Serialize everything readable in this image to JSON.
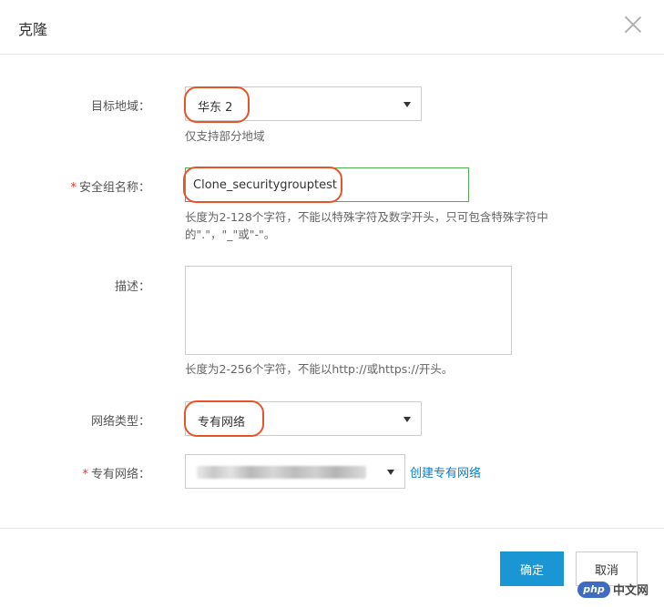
{
  "dialog": {
    "title": "克隆"
  },
  "form": {
    "region": {
      "label": "目标地域：",
      "value": "华东 2",
      "hint": "仅支持部分地域"
    },
    "group_name": {
      "required_mark": "*",
      "label": "安全组名称：",
      "value": "Clone_securitygrouptest",
      "hint_line1": "长度为2-128个字符，不能以特殊字符及数字开头，只可包含特殊字符中",
      "hint_line2": "的\".\"，\"_\"或\"-\"。"
    },
    "description": {
      "label": "描述：",
      "value": "",
      "hint": "长度为2-256个字符，不能以http://或https://开头。"
    },
    "network_type": {
      "label": "网络类型：",
      "value": "专有网络"
    },
    "vpc": {
      "required_mark": "*",
      "label": "专有网络：",
      "create_link": "创建专有网络"
    }
  },
  "footer": {
    "confirm_label": "确定",
    "cancel_label": "取消"
  },
  "watermark": {
    "badge": "php",
    "text": "中文网"
  },
  "colors": {
    "primary_button": "#1a96d4",
    "annotation_oval": "#e8542a",
    "focused_border": "#4caf50",
    "link": "#0a7bd1",
    "required": "#e5322d"
  }
}
